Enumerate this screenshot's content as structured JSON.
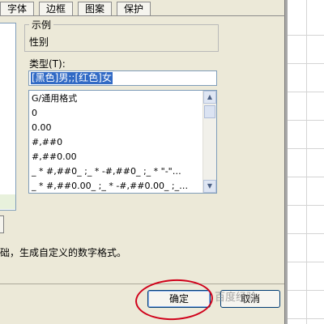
{
  "tabs": [
    "字体",
    "边框",
    "图案",
    "保护"
  ],
  "sample": {
    "legend": "示例",
    "value": "性别"
  },
  "type": {
    "label": "类型(T):",
    "value": "[黑色]男;;[红色]女"
  },
  "format_list": [
    "G/通用格式",
    "0",
    "0.00",
    "#,##0",
    "#,##0.00",
    "_ * #,##0_ ;_ * -#,##0_ ;_ * \"-\"…",
    "_ * #,##0.00_ ;_ * -#,##0.00_ ;_…"
  ],
  "description": "础，生成自定义的数字格式。",
  "buttons": {
    "ok": "确定",
    "cancel": "取消"
  },
  "watermark": "百度经验",
  "colors": {
    "highlight": "#316ac5",
    "annotation": "#d0021b",
    "dialog_bg": "#ece9d8"
  }
}
